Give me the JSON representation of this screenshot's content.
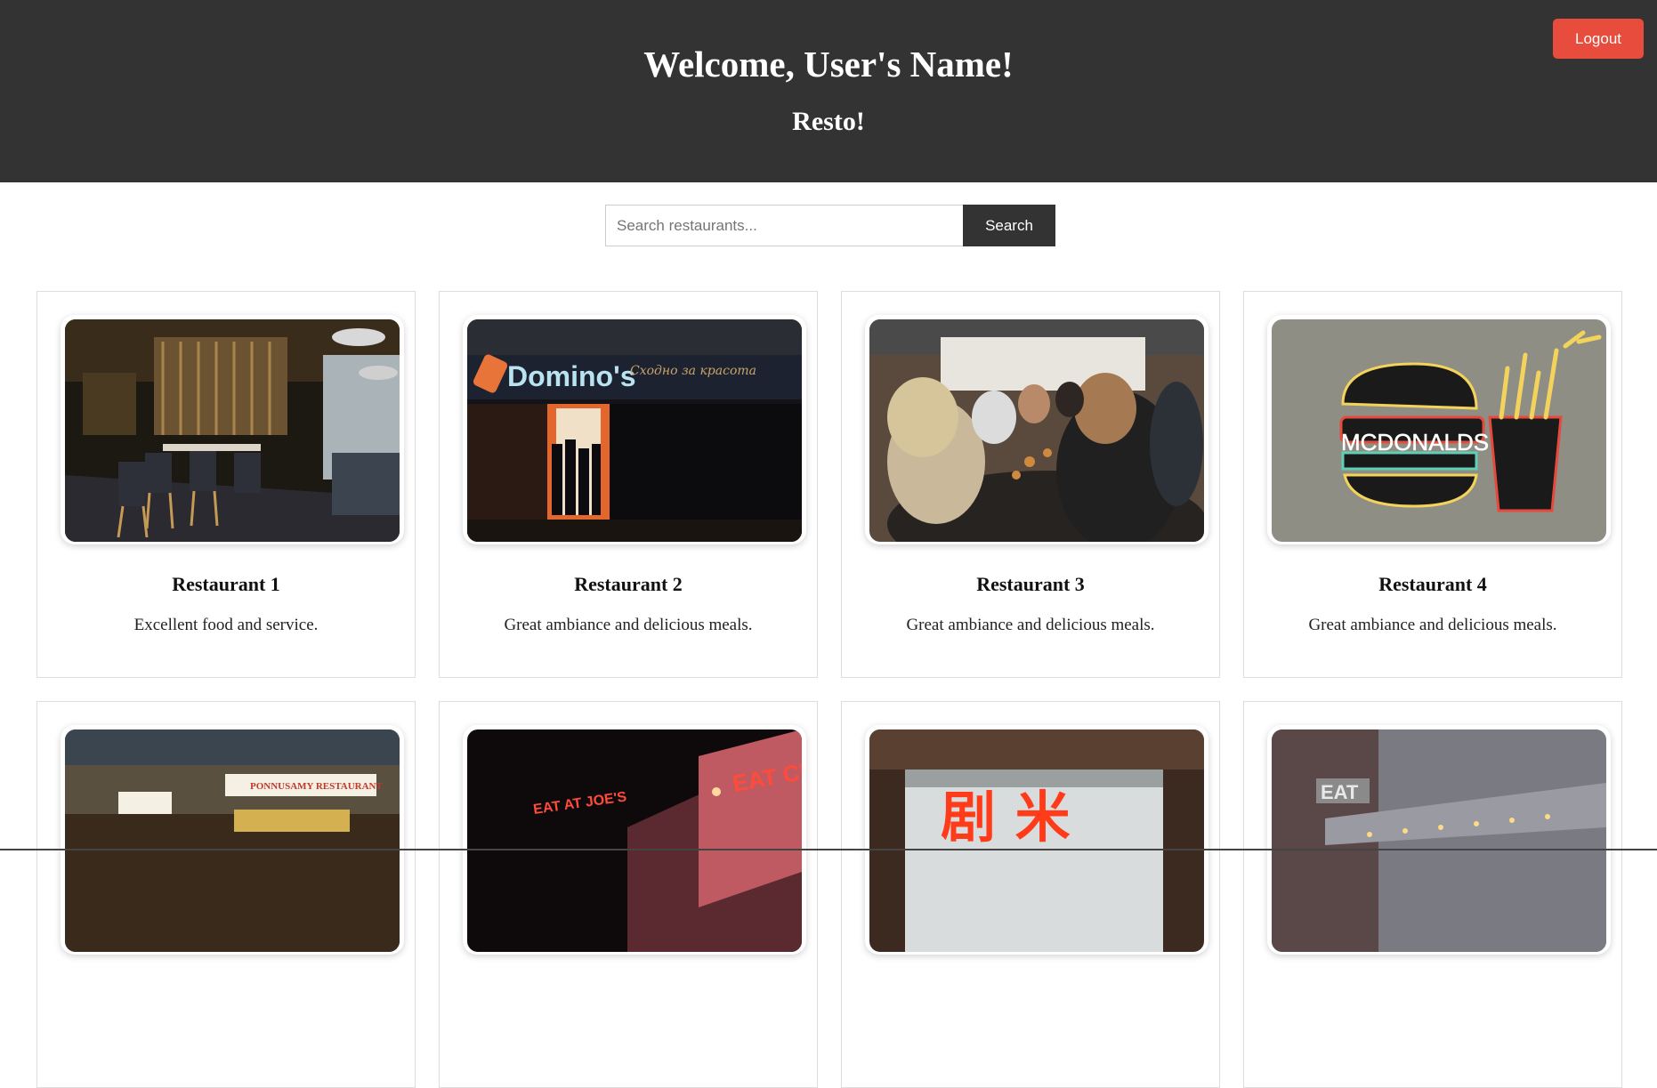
{
  "header": {
    "welcome": "Welcome, User's Name!",
    "subtitle": "Resto!",
    "logout_label": "Logout"
  },
  "search": {
    "placeholder": "Search restaurants...",
    "value": "",
    "button_label": "Search"
  },
  "restaurants": [
    {
      "name": "Restaurant 1",
      "description": "Excellent food and service.",
      "image": "restaurant-interior-photo"
    },
    {
      "name": "Restaurant 2",
      "description": "Great ambiance and delicious meals.",
      "image": "dominos-storefront-photo",
      "sign_text": "Domino's",
      "sign_script": "Сходно за красота"
    },
    {
      "name": "Restaurant 3",
      "description": "Great ambiance and delicious meals.",
      "image": "diners-at-table-photo"
    },
    {
      "name": "Restaurant 4",
      "description": "Great ambiance and delicious meals.",
      "image": "mcdonalds-neon-sign-photo",
      "sign_text": "MCDONALDS"
    },
    {
      "image": "ponnusamy-restaurant-photo",
      "sign_text": "PONNUSAMY RESTAURANT"
    },
    {
      "image": "eat-at-joes-neon-photo",
      "sign_text": "EAT AT JOE'S",
      "sign_text_2": "EAT CRAB"
    },
    {
      "image": "chinese-restaurant-sign-photo",
      "sign_text": "剧 米"
    },
    {
      "image": "eat-diner-corner-photo",
      "sign_text": "EAT"
    }
  ],
  "colors": {
    "header_bg": "#333333",
    "logout_bg": "#e74c3c",
    "search_button_bg": "#333333"
  }
}
